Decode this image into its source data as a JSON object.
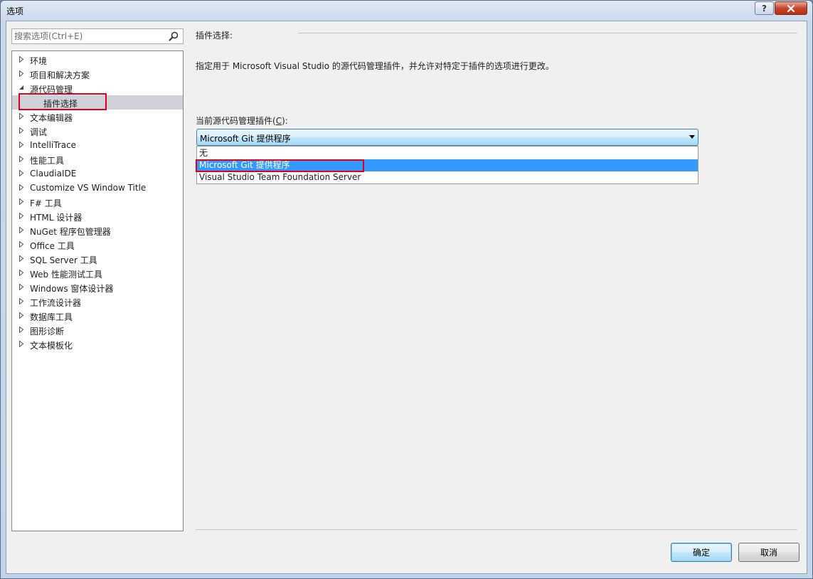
{
  "window": {
    "title": "选项",
    "help_label": "?",
    "close_label": "x"
  },
  "search": {
    "placeholder": "搜索选项(Ctrl+E)"
  },
  "tree": {
    "items": [
      {
        "label": "环境",
        "expanded": false
      },
      {
        "label": "项目和解决方案",
        "expanded": false
      },
      {
        "label": "源代码管理",
        "expanded": true
      },
      {
        "label": "插件选择",
        "child": true,
        "selected": true
      },
      {
        "label": "文本编辑器",
        "expanded": false
      },
      {
        "label": "调试",
        "expanded": false
      },
      {
        "label": "IntelliTrace",
        "expanded": false
      },
      {
        "label": "性能工具",
        "expanded": false
      },
      {
        "label": "ClaudiaIDE",
        "expanded": false
      },
      {
        "label": "Customize VS Window Title",
        "expanded": false
      },
      {
        "label": "F# 工具",
        "expanded": false
      },
      {
        "label": "HTML 设计器",
        "expanded": false
      },
      {
        "label": "NuGet 程序包管理器",
        "expanded": false
      },
      {
        "label": "Office 工具",
        "expanded": false
      },
      {
        "label": "SQL Server 工具",
        "expanded": false
      },
      {
        "label": "Web 性能测试工具",
        "expanded": false
      },
      {
        "label": "Windows 窗体设计器",
        "expanded": false
      },
      {
        "label": "工作流设计器",
        "expanded": false
      },
      {
        "label": "数据库工具",
        "expanded": false
      },
      {
        "label": "图形诊断",
        "expanded": false
      },
      {
        "label": "文本模板化",
        "expanded": false
      }
    ]
  },
  "panel": {
    "section_title": "插件选择:",
    "description": "指定用于 Microsoft Visual Studio 的源代码管理插件，并允许对特定于插件的选项进行更改。",
    "combo_label_prefix": "当前源代码管理插件(",
    "combo_label_key": "C",
    "combo_label_suffix": "):",
    "combo_value": "Microsoft Git 提供程序",
    "options": [
      "无",
      "Microsoft Git 提供程序",
      "Visual Studio Team Foundation Server"
    ],
    "highlighted_option": "Microsoft Git 提供程序"
  },
  "buttons": {
    "ok": "确定",
    "cancel": "取消"
  },
  "colors": {
    "highlight": "#3399ff",
    "annotation_red": "#e0001b",
    "tree_selected": "#cfd0d8"
  }
}
